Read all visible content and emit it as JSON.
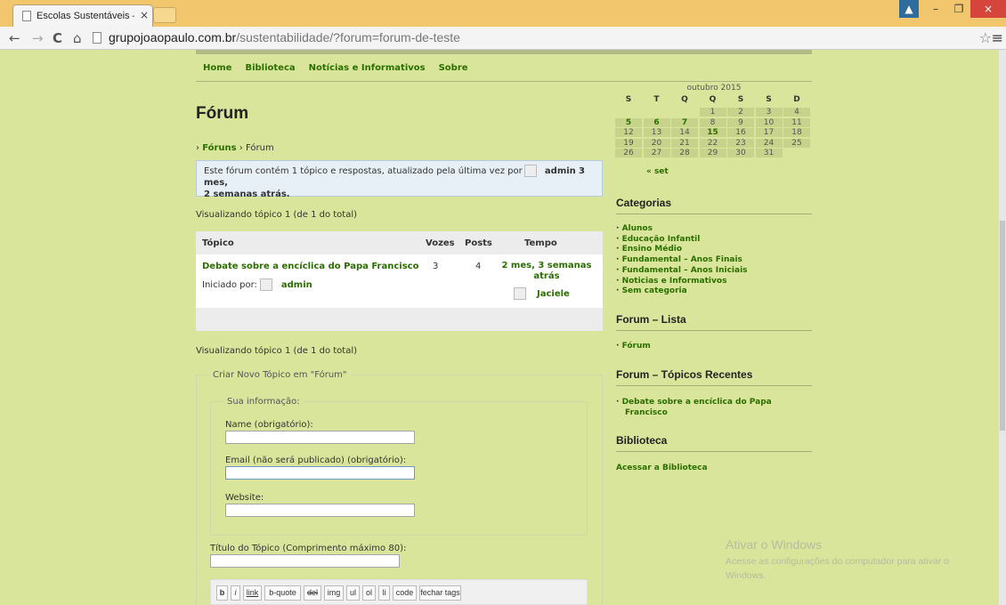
{
  "browser": {
    "tab_title": "Escolas Sustentáveis – Col",
    "tab_close": "×",
    "url_host": "grupojoaopaulo.com.br",
    "url_rest": "/sustentabilidade/?forum=forum-de-teste",
    "back_icon": "←",
    "forward_icon": "→",
    "reload_icon": "C",
    "home_icon": "⌂",
    "star_icon": "☆",
    "menu_icon": "≡",
    "win_min": "–",
    "win_max": "❐",
    "win_close": "×"
  },
  "nav": {
    "items": [
      "Home",
      "Biblioteca",
      "Notícias e Informativos",
      "Sobre"
    ]
  },
  "main": {
    "title": "Fórum",
    "breadcrumb_sep": "›",
    "breadcrumb_link": "Fóruns",
    "breadcrumb_current": "Fórum",
    "notice_text": "Este fórum contém 1 tópico e respostas, atualizado pela última vez por",
    "notice_author": "admin",
    "notice_time_1": "3 mes,",
    "notice_time_2": "2 semanas atrás.",
    "viewing_top": "Visualizando tópico 1 (de 1 do total)",
    "viewing_bottom": "Visualizando tópico 1 (de 1 do total)",
    "table": {
      "headers": {
        "topic": "Tópico",
        "voices": "Vozes",
        "posts": "Posts",
        "time": "Tempo"
      },
      "rows": [
        {
          "title": "Debate sobre a encíclica do Papa Francisco",
          "started_label": "Iniciado por:",
          "started_by": "admin",
          "voices": "3",
          "posts": "4",
          "freshness_1": "2 mes, 3 semanas",
          "freshness_2": "atrás",
          "last_author": "Jaciele"
        }
      ]
    },
    "form": {
      "legend": "Criar Novo Tópico em \"Fórum\"",
      "info_legend": "Sua informação:",
      "name_label": "Name (obrigatório):",
      "email_label": "Email (não será publicado) (obrigatório):",
      "website_label": "Website:",
      "topic_title_label": "Título do Tópico (Comprimento máximo 80):",
      "quicktags": [
        "b",
        "i",
        "link",
        "b-quote",
        "del",
        "img",
        "ul",
        "ol",
        "li",
        "code",
        "fechar tags"
      ]
    }
  },
  "sidebar": {
    "calendar": {
      "caption": "outubro 2015",
      "headers": [
        "S",
        "T",
        "Q",
        "Q",
        "S",
        "S",
        "D"
      ],
      "weeks": [
        [
          "",
          "",
          "",
          "1",
          "2",
          "3",
          "4"
        ],
        [
          "5",
          "6",
          "7",
          "8",
          "9",
          "10",
          "11"
        ],
        [
          "12",
          "13",
          "14",
          "15",
          "16",
          "17",
          "18"
        ],
        [
          "19",
          "20",
          "21",
          "22",
          "23",
          "24",
          "25"
        ],
        [
          "26",
          "27",
          "28",
          "29",
          "30",
          "31",
          ""
        ]
      ],
      "linked_days": [
        "5",
        "6",
        "7",
        "15"
      ],
      "prev": "« set"
    },
    "categorias_title": "Categorias",
    "categorias": [
      "Alunos",
      "Educação Infantil",
      "Ensino Médio",
      "Fundamental – Anos Finais",
      "Fundamental – Anos Iniciais",
      "Noticias e Informativos",
      "Sem categoria"
    ],
    "forum_lista_title": "Forum – Lista",
    "forum_lista": [
      "Fórum"
    ],
    "recentes_title": "Forum – Tópicos Recentes",
    "recentes_1": "Debate sobre a encíclica do Papa",
    "recentes_2": "Francisco",
    "biblioteca_title": "Biblioteca",
    "biblioteca_link": "Acessar a Biblioteca"
  },
  "watermark": {
    "line1": "Ativar o Windows",
    "line2": "Acesse as configurações do computador para ativar o",
    "line3": "Windows."
  },
  "colors": {
    "page_bg": "#d9e59a",
    "link": "#2b6e00",
    "titlebar": "#f2c66d"
  }
}
